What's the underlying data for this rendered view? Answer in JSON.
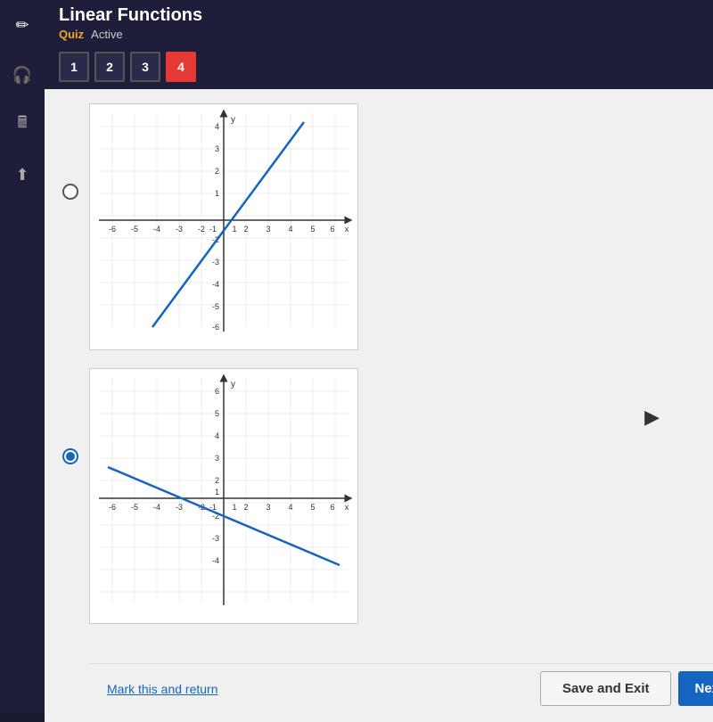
{
  "header": {
    "title": "Linear Functions",
    "quiz_label": "Quiz",
    "active_label": "Active"
  },
  "tabs": [
    {
      "label": "1",
      "active": false
    },
    {
      "label": "2",
      "active": false
    },
    {
      "label": "3",
      "active": false
    },
    {
      "label": "4",
      "active": true
    }
  ],
  "options": [
    {
      "id": "option1",
      "selected": false
    },
    {
      "id": "option2",
      "selected": true
    }
  ],
  "bottom": {
    "mark_return": "Mark this and return",
    "save_exit": "Save and Exit",
    "next": "Next"
  },
  "icons": {
    "pencil": "✏",
    "headphones": "🎧",
    "calculator": "🖩",
    "arrow_up": "↑"
  }
}
